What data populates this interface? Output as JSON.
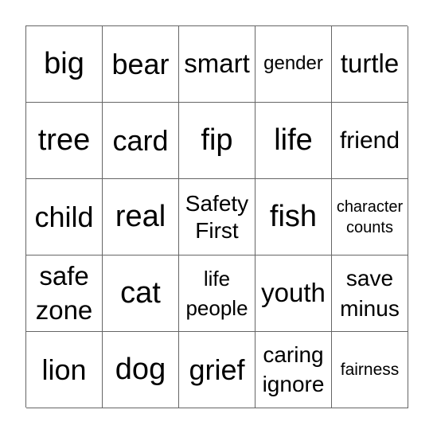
{
  "board": {
    "rows": [
      [
        "big",
        "bear",
        "smart",
        "gender",
        "turtle"
      ],
      [
        "tree",
        "card",
        "fip",
        "life",
        "friend"
      ],
      [
        "child",
        "real",
        "Safety\nFirst",
        "fish",
        "character\ncounts"
      ],
      [
        "safe\nzone",
        "cat",
        "life\npeople",
        "youth",
        "save\nminus"
      ],
      [
        "lion",
        "dog",
        "grief",
        "caring\nignore",
        "fairness"
      ]
    ]
  },
  "colors": {
    "grid_line": "#666666",
    "text": "#000000",
    "background": "#ffffff"
  }
}
